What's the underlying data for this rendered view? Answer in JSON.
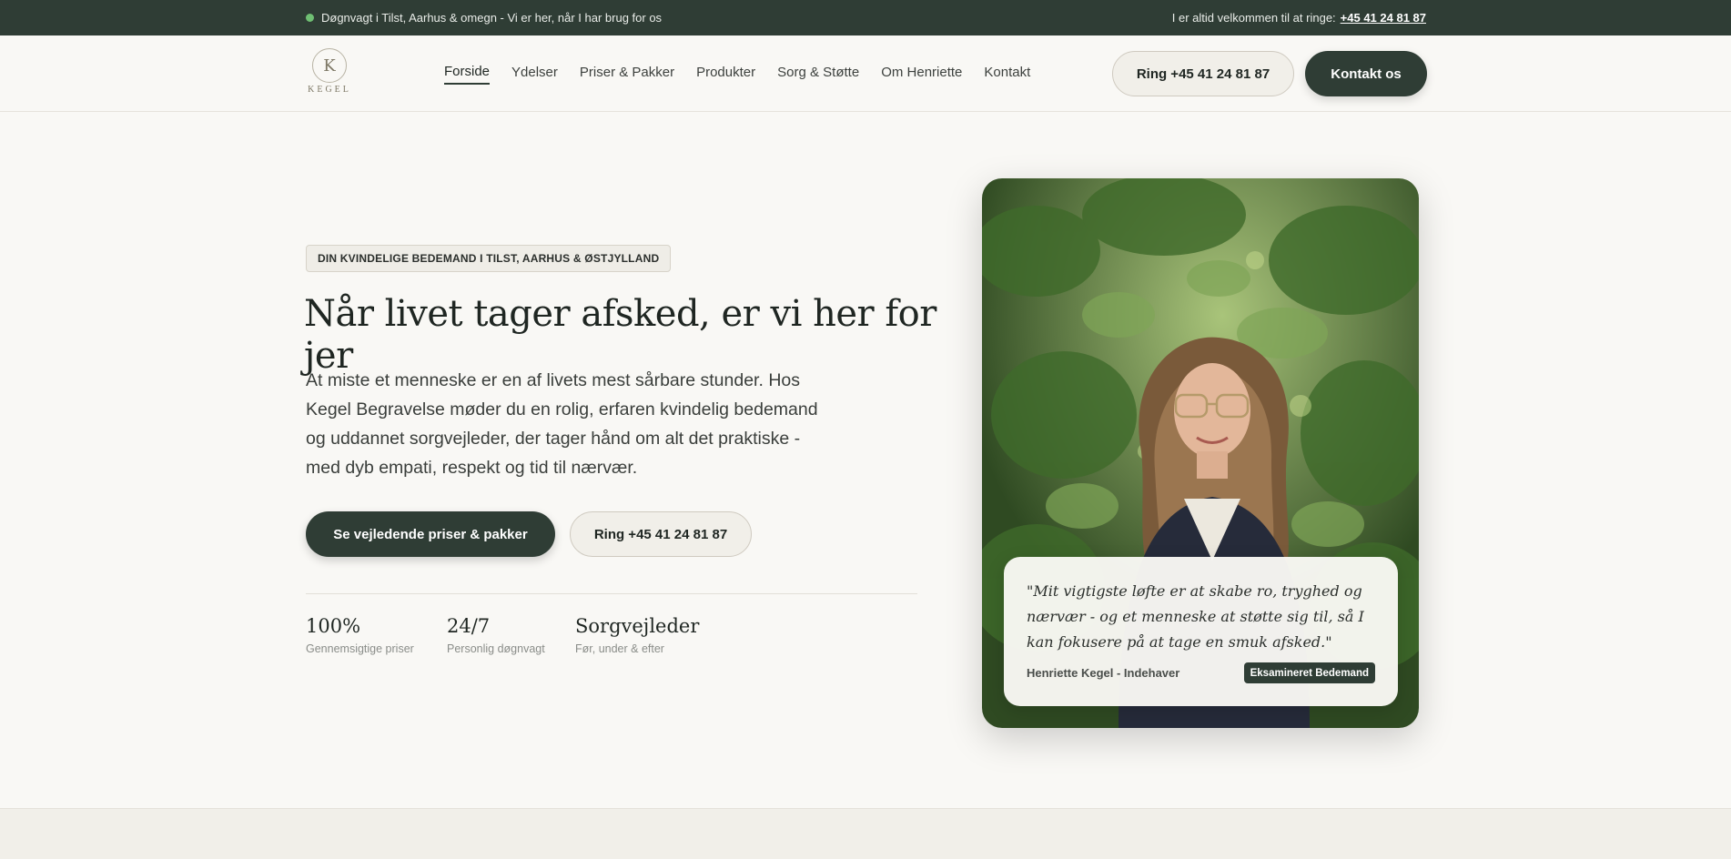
{
  "topbar": {
    "status_text": "Døgnvagt i Tilst, Aarhus & omegn - Vi er her, når I har brug for os",
    "call_prefix": "I er altid velkommen til at ringe:",
    "phone": "+45 41 24 81 87"
  },
  "header": {
    "logo_letter": "K",
    "logo_word": "KEGEL",
    "nav": [
      "Forside",
      "Ydelser",
      "Priser & Pakker",
      "Produkter",
      "Sorg & Støtte",
      "Om Henriette",
      "Kontakt"
    ],
    "active_nav": "Forside",
    "call_button": "Ring +45 41 24 81 87",
    "contact_button": "Kontakt os"
  },
  "hero": {
    "badge": "DIN KVINDELIGE BEDEMAND I TILST, AARHUS & ØSTJYLLAND",
    "title": "Når livet tager afsked, er vi her for jer",
    "lead": "At miste et menneske er en af livets mest sårbare stunder. Hos Kegel Begravelse møder du en rolig, erfaren kvindelig bedemand og uddannet sorgvejleder, der tager hånd om alt det praktiske - med dyb empati, respekt og tid til nærvær.",
    "primary_button": "Se vejledende priser & pakker",
    "secondary_button": "Ring +45 41 24 81 87",
    "stats": [
      {
        "value": "100%",
        "label": "Gennemsigtige priser"
      },
      {
        "value": "24/7",
        "label": "Personlig døgnvagt"
      },
      {
        "value": "Sorgvejleder",
        "label": "Før, under & efter"
      }
    ]
  },
  "quote_card": {
    "quote": "\"Mit vigtigste løfte er at skabe ro, tryghed og nærvær - og et menneske at støtte sig til, så I kan fokusere på at tage en smuk afsked.\"",
    "author": "Henriette Kegel - Indehaver",
    "tag": "Eksamineret Bedemand"
  },
  "colors": {
    "primary": "#2f3d35",
    "background": "#f9f8f5",
    "status_dot": "#6fbf73"
  }
}
